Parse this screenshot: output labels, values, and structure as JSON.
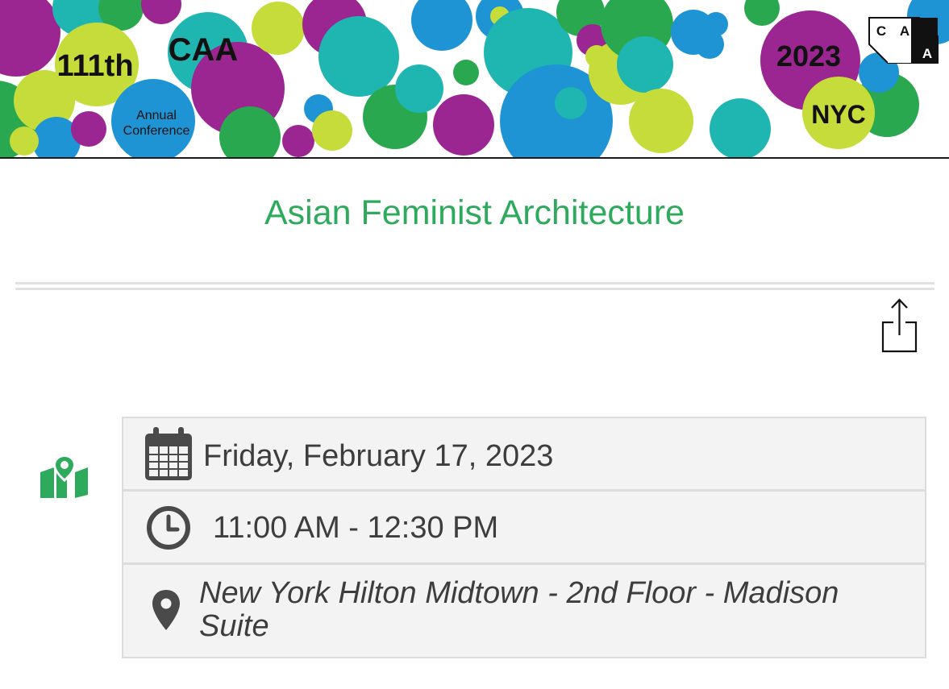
{
  "banner": {
    "edition": "111th",
    "org": "CAA",
    "subtitle_line1": "Annual",
    "subtitle_line2": "Conference",
    "year": "2023",
    "city": "NYC",
    "logo": {
      "letters": [
        "C",
        "A",
        "A"
      ]
    },
    "colors": {
      "purple": "#9b2591",
      "blue": "#1e94d4",
      "teal": "#1fb5b0",
      "lime": "#c6dc3a",
      "green": "#2aa84f"
    }
  },
  "event": {
    "title": "Asian Feminist Architecture",
    "date": "Friday, February 17, 2023",
    "time": "11:00 AM - 12:30 PM",
    "location_line1": "New York Hilton Midtown - 2nd Floor - Madison",
    "location_line2": "Suite"
  },
  "icons": {
    "share": "share-icon",
    "map": "map-icon",
    "calendar": "calendar-icon",
    "clock": "clock-icon",
    "location": "location-pin-icon"
  },
  "colors": {
    "title_green": "#2eaa5c",
    "text": "#3d3d3d",
    "icon_dark": "#4a4a4a",
    "panel_bg": "#f3f3f3"
  }
}
